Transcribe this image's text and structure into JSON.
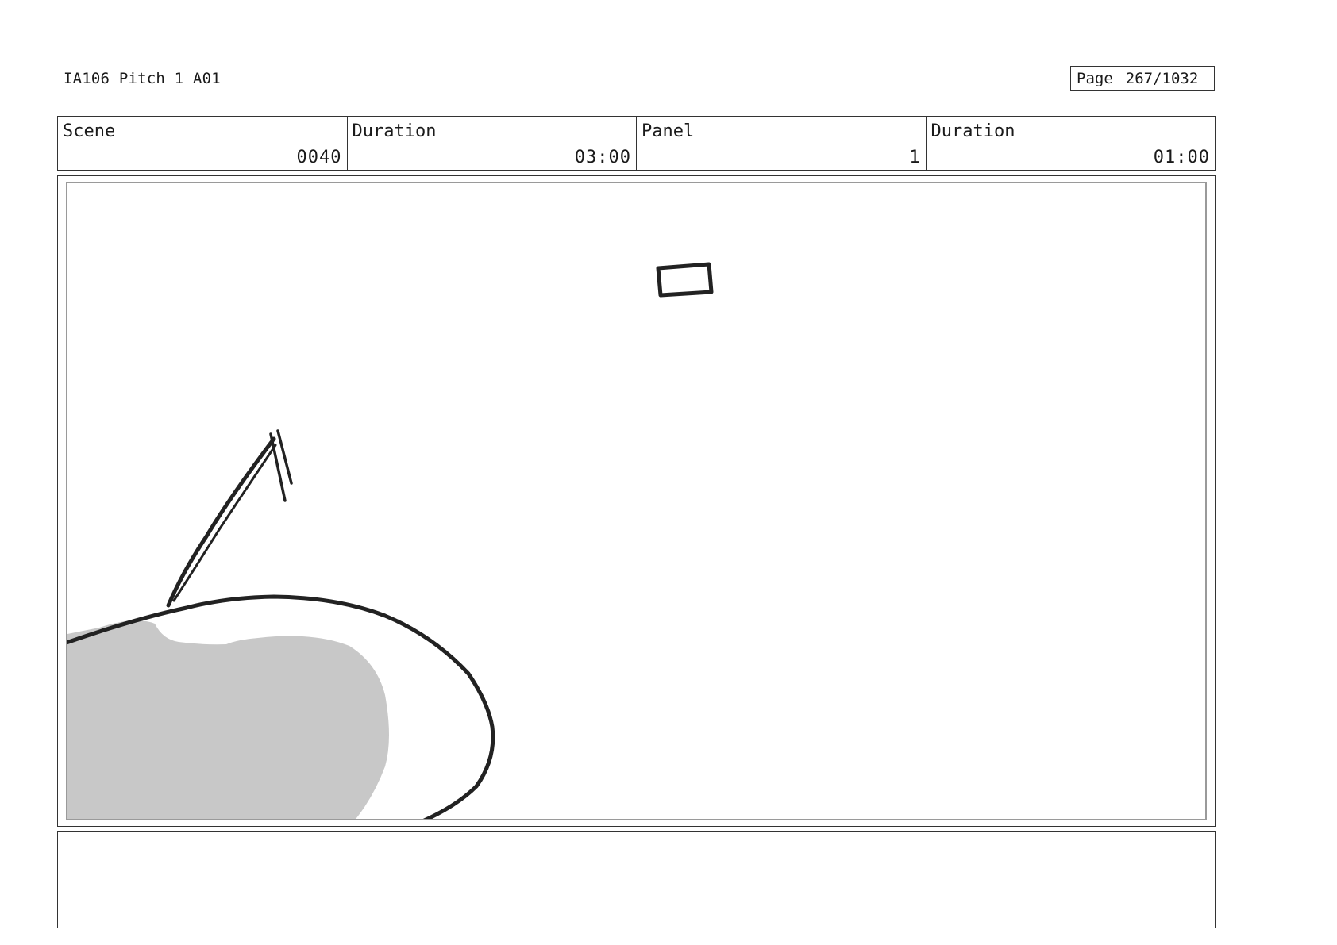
{
  "header": {
    "project_title": "IA106 Pitch 1 A01",
    "page_label": "Page",
    "page_value": "267/1032"
  },
  "info": {
    "scene_label": "Scene",
    "scene_value": "0040",
    "scene_duration_label": "Duration",
    "scene_duration_value": "03:00",
    "panel_label": "Panel",
    "panel_value": "1",
    "panel_duration_label": "Duration",
    "panel_duration_value": "01:00"
  },
  "notes": {
    "text": ""
  },
  "colors": {
    "line": "#222222",
    "shade": "#c8c8c8",
    "frame_inner": "#9a9a9a"
  }
}
